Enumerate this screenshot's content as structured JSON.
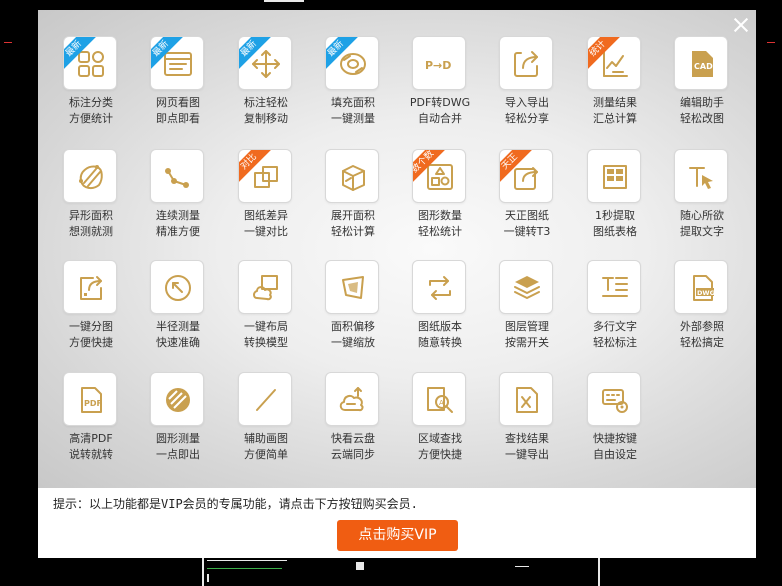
{
  "dialog": {
    "notice": "提示：以上功能都是VIP会员的专属功能，请点击下方按钮购买会员.",
    "buy_button": "点击购买VIP",
    "close_label": "×"
  },
  "colors": {
    "icon": "#c9a04f",
    "badge_blue": "#1ea1e6",
    "badge_orange": "#f06a1f",
    "buy_button": "#f05d12"
  },
  "features": [
    {
      "line1": "标注分类",
      "line2": "方便统计",
      "badge": "最新",
      "badge_color": "blue",
      "icon": "grid-shapes-icon"
    },
    {
      "line1": "网页看图",
      "line2": "即点即看",
      "badge": "最新",
      "badge_color": "blue",
      "icon": "browser-window-icon"
    },
    {
      "line1": "标注轻松",
      "line2": "复制移动",
      "badge": "最新",
      "badge_color": "blue",
      "icon": "move-arrows-icon"
    },
    {
      "line1": "填充面积",
      "line2": "一键测量",
      "badge": "最新",
      "badge_color": "blue",
      "icon": "fill-area-icon"
    },
    {
      "line1": "PDF转DWG",
      "line2": "自动合并",
      "badge": "",
      "badge_color": "",
      "icon": "pdf-to-dwg-icon"
    },
    {
      "line1": "导入导出",
      "line2": "轻松分享",
      "badge": "",
      "badge_color": "",
      "icon": "import-export-icon"
    },
    {
      "line1": "测量结果",
      "line2": "汇总计算",
      "badge": "统计",
      "badge_color": "orange",
      "icon": "measure-chart-icon"
    },
    {
      "line1": "编辑助手",
      "line2": "轻松改图",
      "badge": "",
      "badge_color": "",
      "icon": "cad-file-icon"
    },
    {
      "line1": "异形面积",
      "line2": "想测就测",
      "badge": "",
      "badge_color": "",
      "icon": "irregular-area-icon"
    },
    {
      "line1": "连续测量",
      "line2": "精准方便",
      "badge": "",
      "badge_color": "",
      "icon": "polyline-icon"
    },
    {
      "line1": "图纸差异",
      "line2": "一键对比",
      "badge": "对比",
      "badge_color": "orange",
      "icon": "compare-icon"
    },
    {
      "line1": "展开面积",
      "line2": "轻松计算",
      "badge": "",
      "badge_color": "",
      "icon": "box-unfold-icon"
    },
    {
      "line1": "图形数量",
      "line2": "轻松统计",
      "badge": "数个数",
      "badge_color": "orange",
      "icon": "shape-count-icon"
    },
    {
      "line1": "天正图纸",
      "line2": "一键转T3",
      "badge": "天正",
      "badge_color": "orange",
      "icon": "share-export-icon"
    },
    {
      "line1": "1秒提取",
      "line2": "图纸表格",
      "badge": "",
      "badge_color": "",
      "icon": "table-extract-icon"
    },
    {
      "line1": "随心所欲",
      "line2": "提取文字",
      "badge": "",
      "badge_color": "",
      "icon": "text-extract-icon"
    },
    {
      "line1": "一键分图",
      "line2": "方便快捷",
      "badge": "",
      "badge_color": "",
      "icon": "split-drawing-icon"
    },
    {
      "line1": "半径测量",
      "line2": "快速准确",
      "badge": "",
      "badge_color": "",
      "icon": "radius-icon"
    },
    {
      "line1": "一键布局",
      "line2": "转换模型",
      "badge": "",
      "badge_color": "",
      "icon": "layout-cloud-icon"
    },
    {
      "line1": "面积偏移",
      "line2": "一键缩放",
      "badge": "",
      "badge_color": "",
      "icon": "area-offset-icon"
    },
    {
      "line1": "图纸版本",
      "line2": "随意转换",
      "badge": "",
      "badge_color": "",
      "icon": "version-convert-icon"
    },
    {
      "line1": "图层管理",
      "line2": "按需开关",
      "badge": "",
      "badge_color": "",
      "icon": "layers-icon"
    },
    {
      "line1": "多行文字",
      "line2": "轻松标注",
      "badge": "",
      "badge_color": "",
      "icon": "multiline-text-icon"
    },
    {
      "line1": "外部参照",
      "line2": "轻松搞定",
      "badge": "",
      "badge_color": "",
      "icon": "dwg-file-icon"
    },
    {
      "line1": "高清PDF",
      "line2": "说转就转",
      "badge": "",
      "badge_color": "",
      "icon": "pdf-file-icon"
    },
    {
      "line1": "圆形测量",
      "line2": "一点即出",
      "badge": "",
      "badge_color": "",
      "icon": "circle-hatch-icon"
    },
    {
      "line1": "辅助画图",
      "line2": "方便简单",
      "badge": "",
      "badge_color": "",
      "icon": "line-draw-icon"
    },
    {
      "line1": "快看云盘",
      "line2": "云端同步",
      "badge": "",
      "badge_color": "",
      "icon": "cloud-sync-icon"
    },
    {
      "line1": "区域查找",
      "line2": "方便快捷",
      "badge": "",
      "badge_color": "",
      "icon": "area-search-icon"
    },
    {
      "line1": "查找结果",
      "line2": "一键导出",
      "badge": "",
      "badge_color": "",
      "icon": "find-export-icon"
    },
    {
      "line1": "快捷按键",
      "line2": "自由设定",
      "badge": "",
      "badge_color": "",
      "icon": "keyboard-settings-icon"
    }
  ]
}
